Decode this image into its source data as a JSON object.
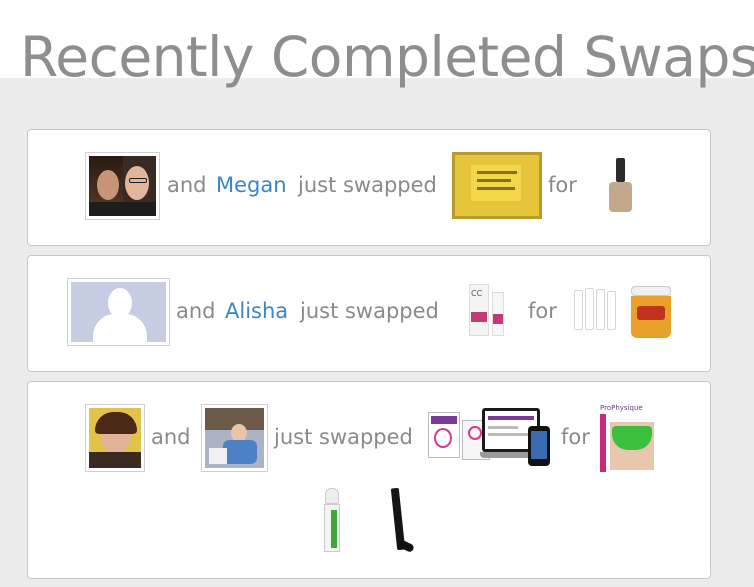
{
  "page": {
    "title": "Recently Completed Swaps"
  },
  "swaps": [
    {
      "connector": "and",
      "partner": "Megan",
      "action": "just swapped",
      "for_word": "for",
      "gave_items": [
        "kusmi-tea-detox-box"
      ],
      "got_items": [
        "nail-polish-bottle"
      ]
    },
    {
      "connector": "and",
      "partner": "Alisha",
      "action": "just swapped",
      "for_word": "for",
      "gave_items": [
        "cc-cream-tubes"
      ],
      "got_items": [
        "glass-vials-set",
        "hair-product-tub"
      ]
    },
    {
      "connector": "and",
      "partner": "",
      "action": "just swapped",
      "for_word": "for",
      "gave_items": [
        "earphones-tablet-phone-bundle"
      ],
      "got_items": [
        "pro-physique-cellulite-box",
        "roll-on-bottle",
        "black-eyeliner-pen"
      ]
    }
  ],
  "colors": {
    "link": "#3a86c8",
    "text": "#8a8a8a",
    "background": "#ececec",
    "card_border": "#c8c8c8"
  }
}
